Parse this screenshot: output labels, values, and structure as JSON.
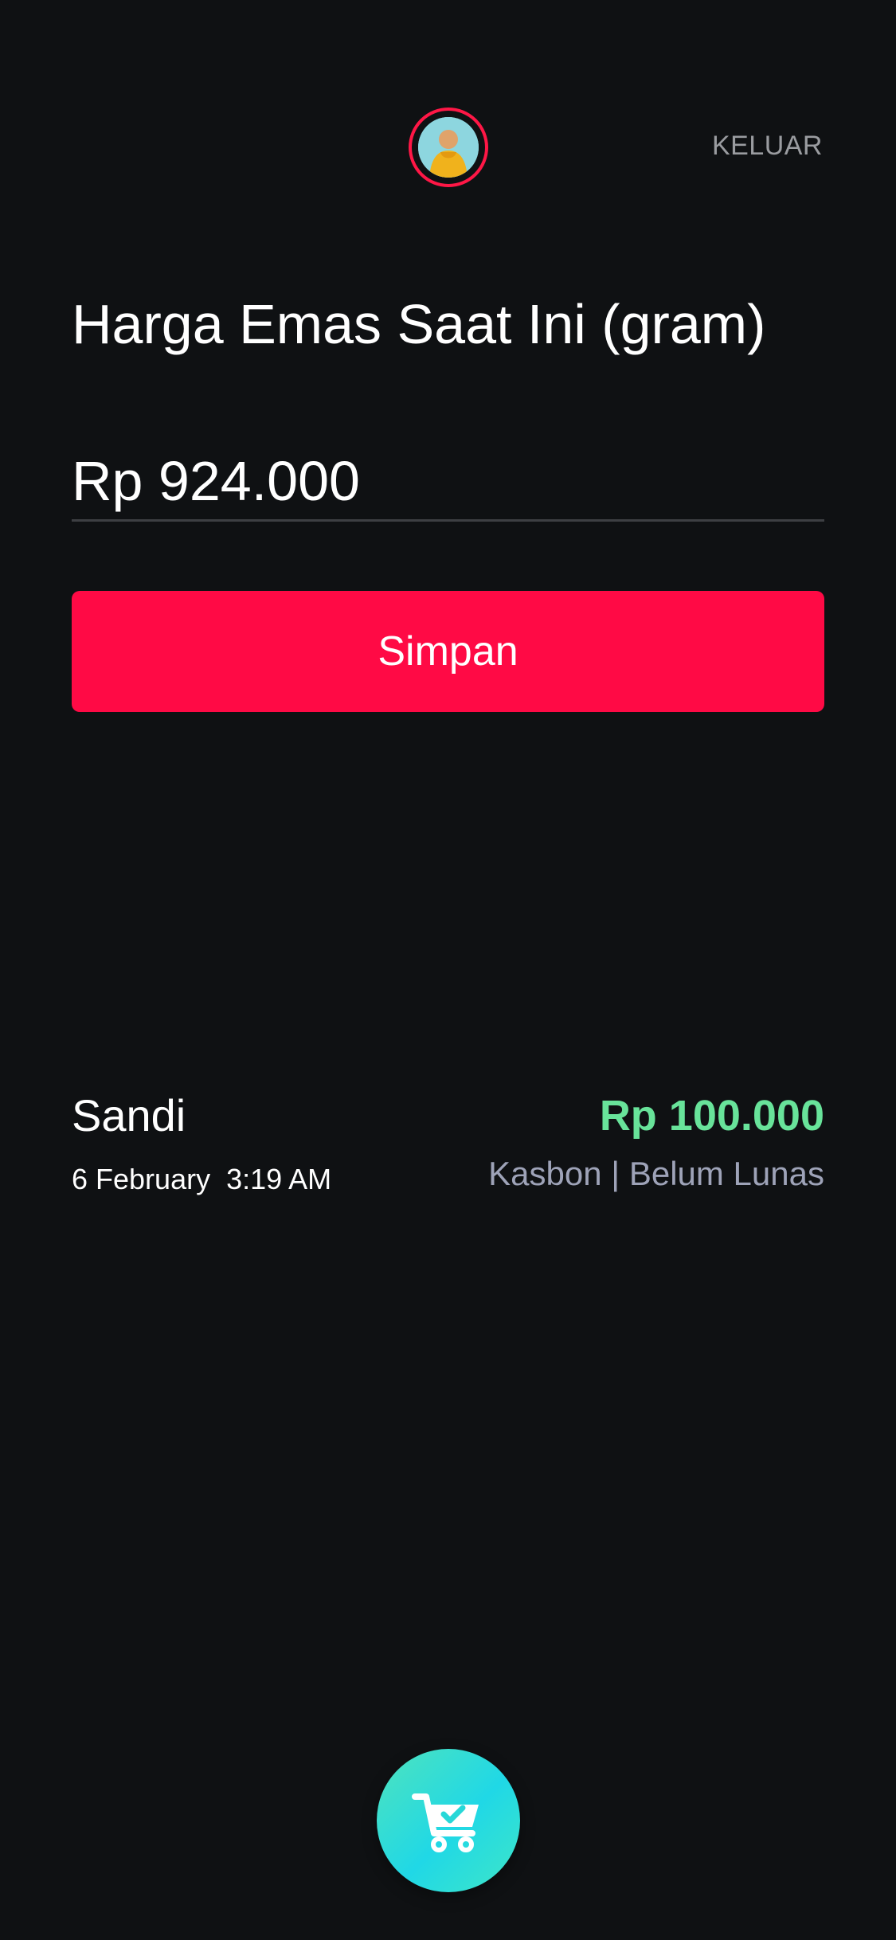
{
  "header": {
    "logout_label": "KELUAR"
  },
  "gold_price": {
    "title": "Harga Emas Saat Ini (gram)",
    "input_value": "Rp 924.000",
    "save_label": "Simpan"
  },
  "transactions": [
    {
      "name": "Sandi",
      "date": "6 February  3:19 AM",
      "amount": "Rp 100.000",
      "status": "Kasbon | Belum Lunas"
    }
  ],
  "colors": {
    "background": "#0f1113",
    "accent": "#ff0a45",
    "amount_positive": "#68e39a",
    "status_muted": "#9ea3b8",
    "fab_gradient_start": "#4fe3bd",
    "fab_gradient_end": "#20d8e6"
  },
  "icons": {
    "avatar": "user-avatar",
    "fab": "cart-check-icon"
  }
}
